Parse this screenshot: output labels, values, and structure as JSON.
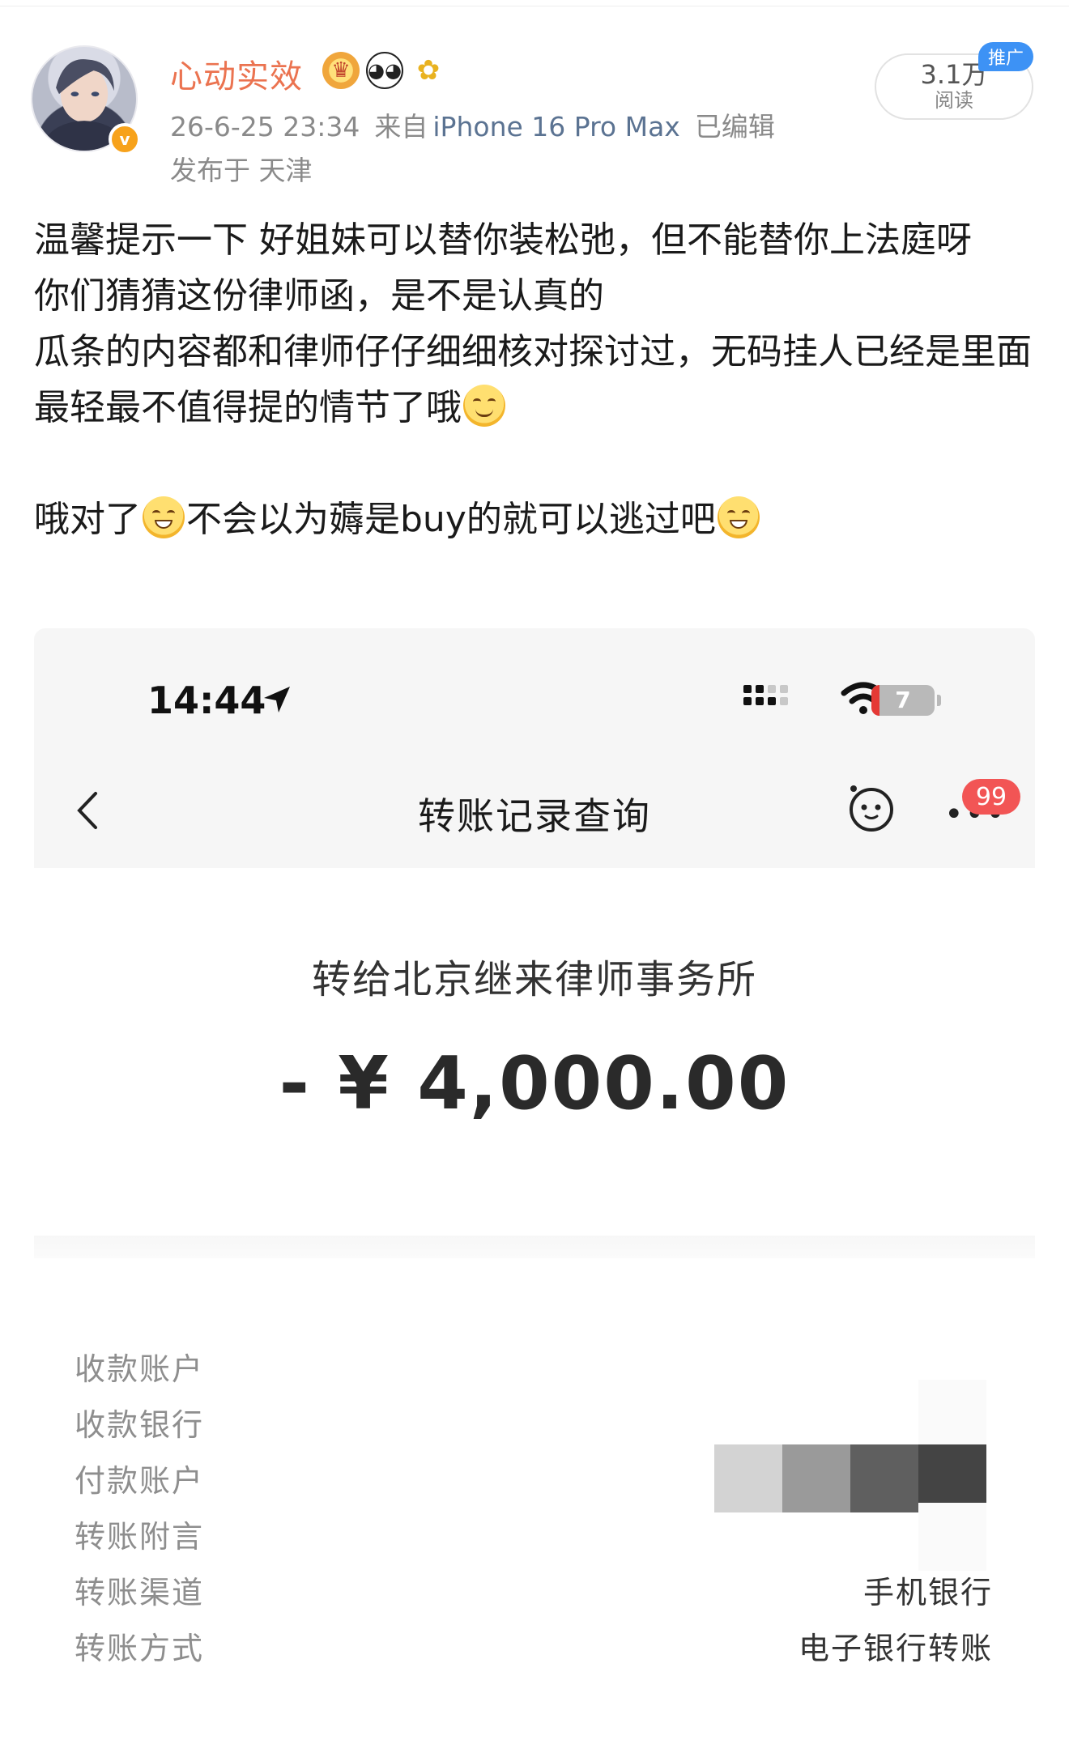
{
  "post": {
    "user_name": "心动实效",
    "timestamp": "26-6-25 23:34",
    "source_prefix": "来自",
    "source_device": "iPhone 16 Pro Max",
    "edited": "已编辑",
    "location": "发布于 天津",
    "read_count": "3.1万",
    "read_label": "阅读",
    "promo_tag": "推广",
    "badges": [
      "crown-badge",
      "panda-badge",
      "sunflower-badge"
    ],
    "body": {
      "line1": "温馨提示一下 好姐妹可以替你装松弛，但不能替你上法庭呀",
      "line2": "你们猜猜这份律师函，是不是认真的",
      "line3": "瓜条的内容都和律师仔仔细细核对探讨过，无码挂人已经是里面最轻最不值得提的情节了哦",
      "line4_part1": "哦对了",
      "line4_part2": "不会以为薅是buy的就可以逃过吧"
    },
    "colors": {
      "username": "#eb7350",
      "verified": "#f7a21b",
      "promo": "#3d92f5",
      "source": "#5b7392"
    }
  },
  "screenshot": {
    "status_time": "14:44",
    "battery_level": "7",
    "nav_title": "转账记录查询",
    "unread_count": "99",
    "recipient_line": "转给北京继来律师事务所",
    "amount": "- ¥ 4,000.00",
    "rows": [
      {
        "label": "收款账户",
        "value": ""
      },
      {
        "label": "收款银行",
        "value": ""
      },
      {
        "label": "付款账户",
        "value": ""
      },
      {
        "label": "转账附言",
        "value": ""
      },
      {
        "label": "转账渠道",
        "value": "手机银行"
      },
      {
        "label": "转账方式",
        "value": "电子银行转账"
      }
    ],
    "mosaic_colors": [
      "#d3d3d3",
      "#9a9a9a",
      "#5f5f5f",
      "#444444"
    ],
    "colors": {
      "badge": "#f25555",
      "battery_low": "#e53935"
    }
  }
}
